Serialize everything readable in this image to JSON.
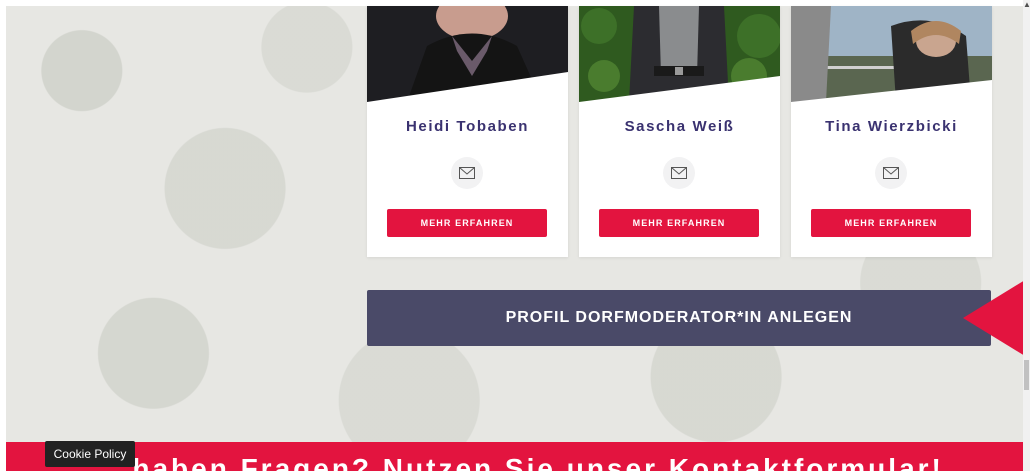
{
  "profiles": [
    {
      "name": "Heidi Tobaben",
      "button_label": "MEHR ERFAHREN",
      "icon": "mail-icon"
    },
    {
      "name": "Sascha Weiß",
      "button_label": "MEHR ERFAHREN",
      "icon": "mail-icon"
    },
    {
      "name": "Tina Wierzbicki",
      "button_label": "MEHR ERFAHREN",
      "icon": "mail-icon"
    }
  ],
  "cta": {
    "label": "PROFIL DORFMODERATOR*IN ANLEGEN"
  },
  "banner": {
    "text": "...haben Fragen? Nutzen Sie unser Kontaktformular!"
  },
  "cookie": {
    "label": "Cookie Policy"
  },
  "colors": {
    "accent": "#e3143f",
    "name_text": "#3a3270",
    "cta_bg": "#4a4a68"
  }
}
